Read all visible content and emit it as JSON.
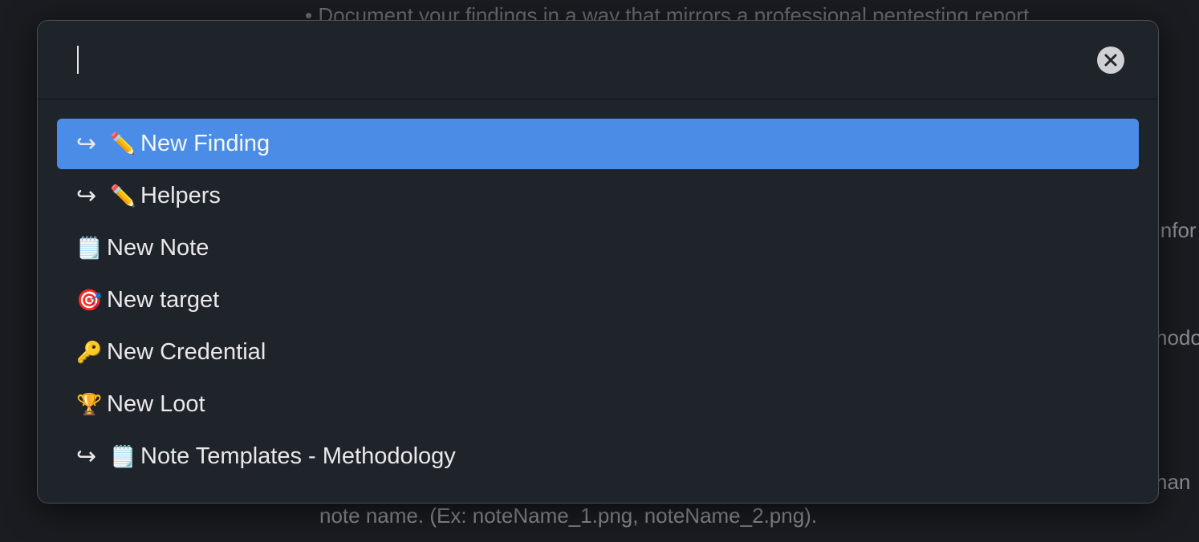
{
  "background": {
    "top_text": "• Document your findings in a way that mirrors a professional pentesting report.",
    "right_fragment_1": "infor",
    "right_fragment_2": "hodo",
    "right_fragment_3": "han",
    "bottom_text": "note name. (Ex: noteName_1.png, noteName_2.png)."
  },
  "search": {
    "value": "",
    "placeholder": ""
  },
  "clear_icon": "×",
  "commands": [
    {
      "prefix": "↪",
      "emoji": "✏️",
      "label": "New Finding",
      "selected": true
    },
    {
      "prefix": "↪",
      "emoji": "✏️",
      "label": "Helpers",
      "selected": false
    },
    {
      "prefix": "",
      "emoji": "🗒️",
      "label": "New Note",
      "selected": false
    },
    {
      "prefix": "",
      "emoji": "🎯",
      "label": "New target",
      "selected": false
    },
    {
      "prefix": "",
      "emoji": "🔑",
      "label": "New Credential",
      "selected": false
    },
    {
      "prefix": "",
      "emoji": "🏆",
      "label": "New Loot",
      "selected": false
    },
    {
      "prefix": "↪",
      "emoji": "🗒️",
      "label": "Note Templates - Methodology",
      "selected": false
    }
  ],
  "colors": {
    "selected_bg": "#4b8de6",
    "modal_bg": "#1f232a",
    "page_bg": "#1a1c21"
  }
}
